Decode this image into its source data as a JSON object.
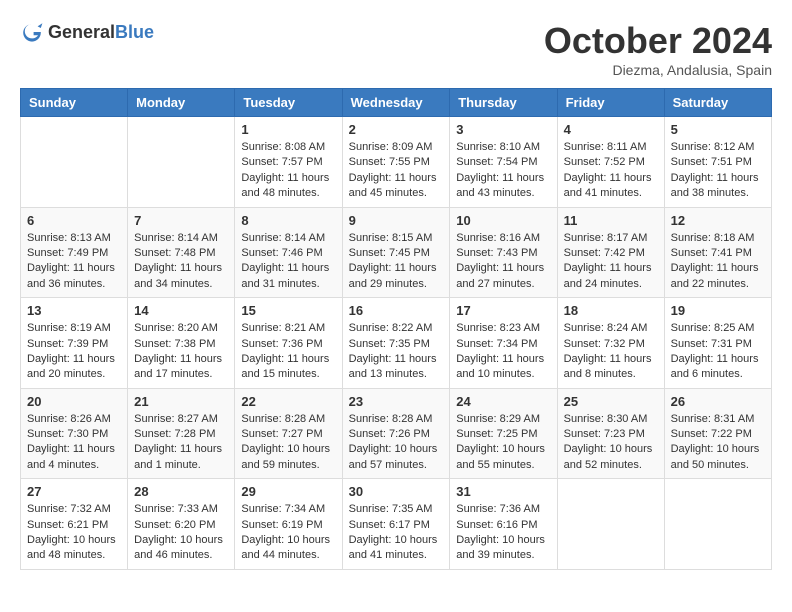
{
  "header": {
    "logo_general": "General",
    "logo_blue": "Blue",
    "month_title": "October 2024",
    "location": "Diezma, Andalusia, Spain"
  },
  "weekdays": [
    "Sunday",
    "Monday",
    "Tuesday",
    "Wednesday",
    "Thursday",
    "Friday",
    "Saturday"
  ],
  "weeks": [
    [
      {
        "day": "",
        "info": ""
      },
      {
        "day": "",
        "info": ""
      },
      {
        "day": "1",
        "info": "Sunrise: 8:08 AM\nSunset: 7:57 PM\nDaylight: 11 hours and 48 minutes."
      },
      {
        "day": "2",
        "info": "Sunrise: 8:09 AM\nSunset: 7:55 PM\nDaylight: 11 hours and 45 minutes."
      },
      {
        "day": "3",
        "info": "Sunrise: 8:10 AM\nSunset: 7:54 PM\nDaylight: 11 hours and 43 minutes."
      },
      {
        "day": "4",
        "info": "Sunrise: 8:11 AM\nSunset: 7:52 PM\nDaylight: 11 hours and 41 minutes."
      },
      {
        "day": "5",
        "info": "Sunrise: 8:12 AM\nSunset: 7:51 PM\nDaylight: 11 hours and 38 minutes."
      }
    ],
    [
      {
        "day": "6",
        "info": "Sunrise: 8:13 AM\nSunset: 7:49 PM\nDaylight: 11 hours and 36 minutes."
      },
      {
        "day": "7",
        "info": "Sunrise: 8:14 AM\nSunset: 7:48 PM\nDaylight: 11 hours and 34 minutes."
      },
      {
        "day": "8",
        "info": "Sunrise: 8:14 AM\nSunset: 7:46 PM\nDaylight: 11 hours and 31 minutes."
      },
      {
        "day": "9",
        "info": "Sunrise: 8:15 AM\nSunset: 7:45 PM\nDaylight: 11 hours and 29 minutes."
      },
      {
        "day": "10",
        "info": "Sunrise: 8:16 AM\nSunset: 7:43 PM\nDaylight: 11 hours and 27 minutes."
      },
      {
        "day": "11",
        "info": "Sunrise: 8:17 AM\nSunset: 7:42 PM\nDaylight: 11 hours and 24 minutes."
      },
      {
        "day": "12",
        "info": "Sunrise: 8:18 AM\nSunset: 7:41 PM\nDaylight: 11 hours and 22 minutes."
      }
    ],
    [
      {
        "day": "13",
        "info": "Sunrise: 8:19 AM\nSunset: 7:39 PM\nDaylight: 11 hours and 20 minutes."
      },
      {
        "day": "14",
        "info": "Sunrise: 8:20 AM\nSunset: 7:38 PM\nDaylight: 11 hours and 17 minutes."
      },
      {
        "day": "15",
        "info": "Sunrise: 8:21 AM\nSunset: 7:36 PM\nDaylight: 11 hours and 15 minutes."
      },
      {
        "day": "16",
        "info": "Sunrise: 8:22 AM\nSunset: 7:35 PM\nDaylight: 11 hours and 13 minutes."
      },
      {
        "day": "17",
        "info": "Sunrise: 8:23 AM\nSunset: 7:34 PM\nDaylight: 11 hours and 10 minutes."
      },
      {
        "day": "18",
        "info": "Sunrise: 8:24 AM\nSunset: 7:32 PM\nDaylight: 11 hours and 8 minutes."
      },
      {
        "day": "19",
        "info": "Sunrise: 8:25 AM\nSunset: 7:31 PM\nDaylight: 11 hours and 6 minutes."
      }
    ],
    [
      {
        "day": "20",
        "info": "Sunrise: 8:26 AM\nSunset: 7:30 PM\nDaylight: 11 hours and 4 minutes."
      },
      {
        "day": "21",
        "info": "Sunrise: 8:27 AM\nSunset: 7:28 PM\nDaylight: 11 hours and 1 minute."
      },
      {
        "day": "22",
        "info": "Sunrise: 8:28 AM\nSunset: 7:27 PM\nDaylight: 10 hours and 59 minutes."
      },
      {
        "day": "23",
        "info": "Sunrise: 8:28 AM\nSunset: 7:26 PM\nDaylight: 10 hours and 57 minutes."
      },
      {
        "day": "24",
        "info": "Sunrise: 8:29 AM\nSunset: 7:25 PM\nDaylight: 10 hours and 55 minutes."
      },
      {
        "day": "25",
        "info": "Sunrise: 8:30 AM\nSunset: 7:23 PM\nDaylight: 10 hours and 52 minutes."
      },
      {
        "day": "26",
        "info": "Sunrise: 8:31 AM\nSunset: 7:22 PM\nDaylight: 10 hours and 50 minutes."
      }
    ],
    [
      {
        "day": "27",
        "info": "Sunrise: 7:32 AM\nSunset: 6:21 PM\nDaylight: 10 hours and 48 minutes."
      },
      {
        "day": "28",
        "info": "Sunrise: 7:33 AM\nSunset: 6:20 PM\nDaylight: 10 hours and 46 minutes."
      },
      {
        "day": "29",
        "info": "Sunrise: 7:34 AM\nSunset: 6:19 PM\nDaylight: 10 hours and 44 minutes."
      },
      {
        "day": "30",
        "info": "Sunrise: 7:35 AM\nSunset: 6:17 PM\nDaylight: 10 hours and 41 minutes."
      },
      {
        "day": "31",
        "info": "Sunrise: 7:36 AM\nSunset: 6:16 PM\nDaylight: 10 hours and 39 minutes."
      },
      {
        "day": "",
        "info": ""
      },
      {
        "day": "",
        "info": ""
      }
    ]
  ]
}
